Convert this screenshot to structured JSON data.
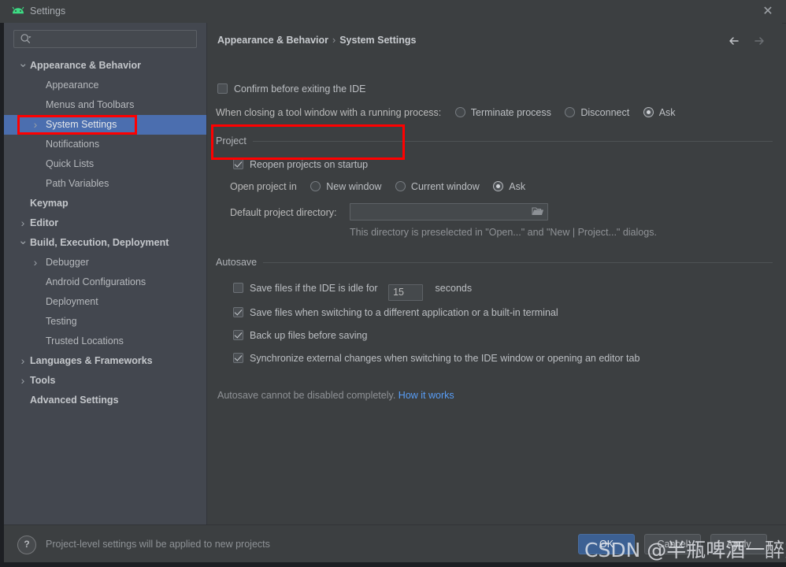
{
  "window": {
    "title": "Settings",
    "app_icon": "android-logo-icon",
    "close_icon": "✕",
    "accent_blue": "#4b6eaf",
    "annotation_color": "#ff0000"
  },
  "search": {
    "value": "",
    "placeholder": "",
    "icon": "search-icon"
  },
  "sidebar": {
    "items": [
      {
        "label": "Appearance & Behavior",
        "depth": 0,
        "arrow": "v",
        "bold": true,
        "selected": false
      },
      {
        "label": "Appearance",
        "depth": 1,
        "arrow": "",
        "bold": false,
        "selected": false
      },
      {
        "label": "Menus and Toolbars",
        "depth": 1,
        "arrow": "",
        "bold": false,
        "selected": false
      },
      {
        "label": "System Settings",
        "depth": 1,
        "arrow": ">",
        "bold": false,
        "selected": true
      },
      {
        "label": "Notifications",
        "depth": 1,
        "arrow": "",
        "bold": false,
        "selected": false
      },
      {
        "label": "Quick Lists",
        "depth": 1,
        "arrow": "",
        "bold": false,
        "selected": false
      },
      {
        "label": "Path Variables",
        "depth": 1,
        "arrow": "",
        "bold": false,
        "selected": false
      },
      {
        "label": "Keymap",
        "depth": 0,
        "arrow": "",
        "bold": true,
        "selected": false
      },
      {
        "label": "Editor",
        "depth": 0,
        "arrow": ">",
        "bold": true,
        "selected": false
      },
      {
        "label": "Build, Execution, Deployment",
        "depth": 0,
        "arrow": "v",
        "bold": true,
        "selected": false
      },
      {
        "label": "Debugger",
        "depth": 1,
        "arrow": ">",
        "bold": false,
        "selected": false
      },
      {
        "label": "Android Configurations",
        "depth": 1,
        "arrow": "",
        "bold": false,
        "selected": false
      },
      {
        "label": "Deployment",
        "depth": 1,
        "arrow": "",
        "bold": false,
        "selected": false
      },
      {
        "label": "Testing",
        "depth": 1,
        "arrow": "",
        "bold": false,
        "selected": false
      },
      {
        "label": "Trusted Locations",
        "depth": 1,
        "arrow": "",
        "bold": false,
        "selected": false
      },
      {
        "label": "Languages & Frameworks",
        "depth": 0,
        "arrow": ">",
        "bold": true,
        "selected": false
      },
      {
        "label": "Tools",
        "depth": 0,
        "arrow": ">",
        "bold": true,
        "selected": false
      },
      {
        "label": "Advanced Settings",
        "depth": 0,
        "arrow": "",
        "bold": true,
        "selected": false
      }
    ]
  },
  "content": {
    "breadcrumb": {
      "parent": "Appearance & Behavior",
      "separator": "›",
      "current": "System Settings"
    },
    "nav": {
      "back_icon": "arrow-left-icon",
      "forward_icon": "arrow-right-icon"
    },
    "confirm_exit": {
      "label": "Confirm before exiting the IDE",
      "checked": false
    },
    "closing_tool_window": {
      "label": "When closing a tool window with a running process:",
      "options": [
        {
          "label": "Terminate process",
          "selected": false
        },
        {
          "label": "Disconnect",
          "selected": false
        },
        {
          "label": "Ask",
          "selected": true
        }
      ]
    },
    "project": {
      "group_title": "Project",
      "reopen": {
        "label": "Reopen projects on startup",
        "checked": true
      },
      "open_project_in": {
        "label": "Open project in",
        "options": [
          {
            "label": "New window",
            "selected": false
          },
          {
            "label": "Current window",
            "selected": false
          },
          {
            "label": "Ask",
            "selected": true
          }
        ]
      },
      "default_dir": {
        "label": "Default project directory:",
        "value": "",
        "browse_icon": "folder-icon",
        "hint": "This directory is preselected in \"Open...\" and \"New | Project...\" dialogs."
      }
    },
    "autosave": {
      "group_title": "Autosave",
      "idle": {
        "label_before": "Save files if the IDE is idle for",
        "seconds_value": "15",
        "label_after": "seconds",
        "checked": false
      },
      "items": [
        {
          "label": "Save files when switching to a different application or a built-in terminal",
          "checked": true
        },
        {
          "label": "Back up files before saving",
          "checked": true
        },
        {
          "label": "Synchronize external changes when switching to the IDE window or opening an editor tab",
          "checked": true
        }
      ],
      "footnote_text": "Autosave cannot be disabled completely.",
      "footnote_link": "How it works"
    }
  },
  "bottom": {
    "help_icon": "?",
    "note": "Project-level settings will be applied to new projects",
    "ok": "OK",
    "cancel": "Cancel",
    "apply": "Apply"
  },
  "watermark": {
    "text": "CSDN @半瓶啤酒一醉方休"
  }
}
